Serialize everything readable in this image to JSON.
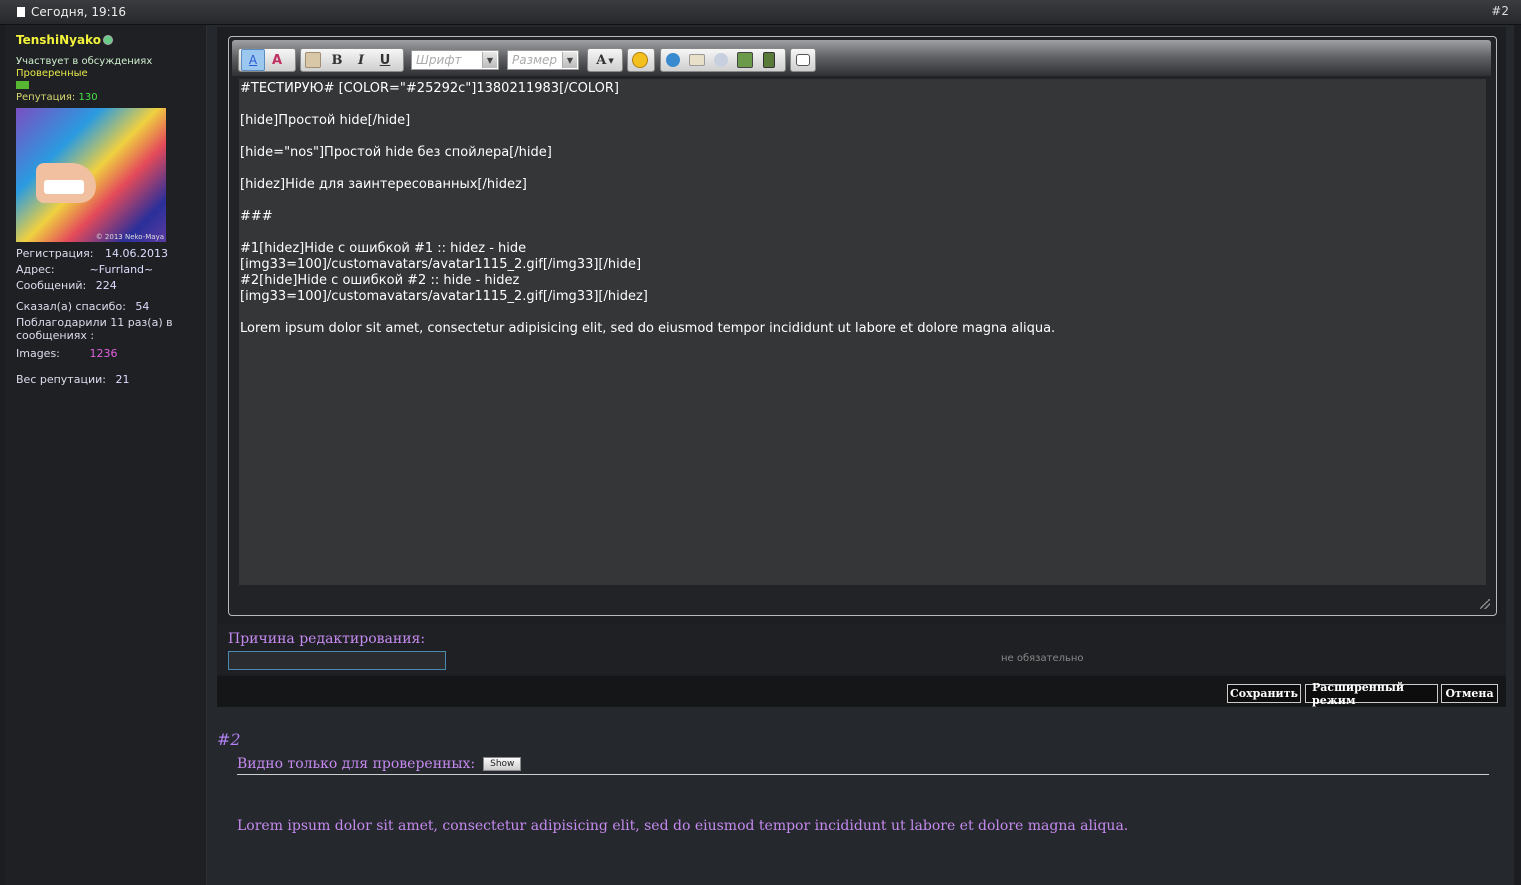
{
  "header": {
    "date": "Сегодня, 19:16",
    "post_number": "#2"
  },
  "user": {
    "name": "TenshiNyako",
    "title": "Участвует в обсуждениях",
    "group": "Проверенные",
    "reputation_label": "Репутация:",
    "reputation_value": "130",
    "avatar_credit": "© 2013 Neko-Maya",
    "registration_label": "Регистрация:",
    "registration_value": "14.06.2013",
    "address_label": "Адрес:",
    "address_value": "~Furrland~",
    "messages_label": "Сообщений:",
    "messages_value": "224",
    "thanks_given_label": "Сказал(а) спасибо:",
    "thanks_given_value": "54",
    "thanked_label": "Поблагодарили 11 раз(а) в сообщениях :",
    "images_label": "Images:",
    "images_value": "1236",
    "rep_weight_label": "Вес репутации:",
    "rep_weight_value": "21"
  },
  "toolbar": {
    "font_placeholder": "Шрифт",
    "size_placeholder": "Размер",
    "icons": [
      "remove-format-icon",
      "switch-mode-icon",
      "paste-icon",
      "bold-icon",
      "italic-icon",
      "underline-icon",
      "font-color-icon",
      "smiley-icon",
      "link-icon",
      "email-icon",
      "image-icon",
      "media-icon",
      "video-icon",
      "quote-icon"
    ],
    "bold": "B",
    "italic": "I",
    "underline": "U",
    "color": "A"
  },
  "editor": {
    "lines": [
      "#ТЕСТИРУЮ# [COLOR=\"#25292c\"]1380211983[/COLOR]",
      "",
      "[hide]Простой hide[/hide]",
      "",
      "[hide=\"nos\"]Простой hide без спойлера[/hide]",
      "",
      "[hidez]Hide для заинтересованных[/hidez]",
      "",
      "###",
      "",
      "#1[hidez]Hide с ошибкой #1 :: hidez - hide",
      "[img33=100]/customavatars/avatar1115_2.gif[/img33][/hide]",
      "#2[hide]Hide с ошибкой #2 :: hide - hidez",
      "[img33=100]/customavatars/avatar1115_2.gif[/img33][/hidez]",
      "",
      "Lorem ipsum dolor sit amet, consectetur adipisicing elit, sed do eiusmod tempor incididunt ut labore et dolore magna aliqua."
    ]
  },
  "reason": {
    "label": "Причина редактирования:",
    "value": "",
    "optional": "не обязательно"
  },
  "buttons": {
    "save": "Сохранить",
    "advanced": "Расширенный режим",
    "cancel": "Отмена"
  },
  "preview": {
    "post_number": "#2",
    "hidden_label": "Видно только для проверенных:",
    "show_button": "Show",
    "text": "Lorem ipsum dolor sit amet, consectetur adipisicing elit, sed do eiusmod tempor incididunt ut labore et dolore magna aliqua."
  }
}
